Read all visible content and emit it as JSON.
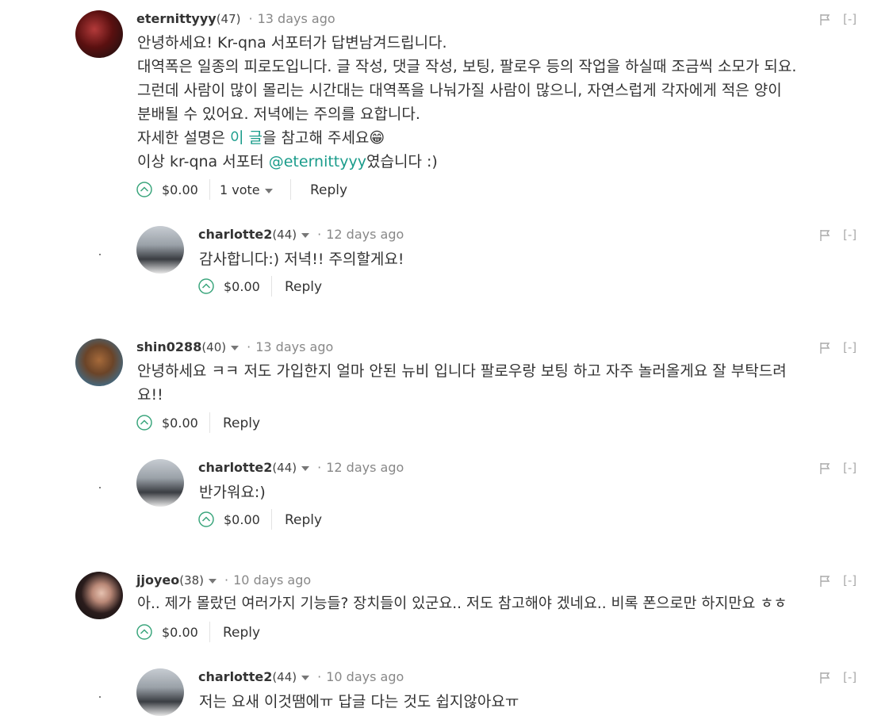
{
  "comments": [
    {
      "author": "eternittyyy",
      "rep": "(47)",
      "time": "13 days ago",
      "lines": [
        "안녕하세요! Kr-qna 서포터가 답변남겨드립니다.",
        "대역폭은 일종의 피로도입니다. 글 작성, 댓글 작성, 보팅, 팔로우 등의 작업을 하실때 조금씩 소모가 되요.",
        "그런데 사람이 많이 몰리는 시간대는 대역폭을 나눠가질 사람이 많으니, 자연스럽게 각자에게 적은 양이",
        "분배될 수 있어요. 저녁에는 주의를 요합니다."
      ],
      "line5_pre": "자세한 설명은 ",
      "line5_link": "이 글",
      "line5_post": "을 참고해 주세요😁",
      "line6_pre": "이상 kr-qna 서포터 ",
      "line6_link": "@eternittyyy",
      "line6_post": "였습니다 :)",
      "payout": "$0.00",
      "votes": "1 vote",
      "reply": "Reply",
      "collapse": "[-]"
    },
    {
      "author": "charlotte2",
      "rep": "(44)",
      "time": "12 days ago",
      "text": "감사합니다:) 저녁!! 주의할게요!",
      "payout": "$0.00",
      "reply": "Reply",
      "collapse": "[-]"
    },
    {
      "author": "shin0288",
      "rep": "(40)",
      "time": "13 days ago",
      "lines": [
        "안녕하세요 ㅋㅋ 저도 가입한지 얼마 안된 뉴비 입니다 팔로우랑 보팅 하고 자주 놀러올게요 잘 부탁드려",
        "요!!"
      ],
      "payout": "$0.00",
      "reply": "Reply",
      "collapse": "[-]"
    },
    {
      "author": "charlotte2",
      "rep": "(44)",
      "time": "12 days ago",
      "text": "반가워요:)",
      "payout": "$0.00",
      "reply": "Reply",
      "collapse": "[-]"
    },
    {
      "author": "jjoyeo",
      "rep": "(38)",
      "time": "10 days ago",
      "text": "아.. 제가 몰랐던 여러가지 기능들? 장치들이 있군요.. 저도 참고해야 겠네요.. 비록 폰으로만 하지만요 ㅎㅎ",
      "payout": "$0.00",
      "reply": "Reply",
      "collapse": "[-]"
    },
    {
      "author": "charlotte2",
      "rep": "(44)",
      "time": "10 days ago",
      "text": "저는 요새 이것땜에ㅠ 답글 다는 것도 쉽지않아요ㅠ",
      "collapse": "[-]"
    }
  ],
  "colors": {
    "accent": "#1a9c8b",
    "upvote": "#3aa57c",
    "muted": "#888888"
  },
  "icons": {
    "upvote": "chevron-up-circle-icon",
    "flag": "flag-icon"
  }
}
